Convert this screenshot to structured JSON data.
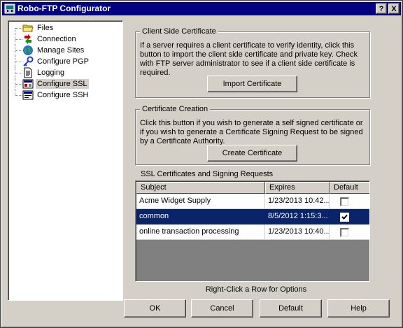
{
  "window": {
    "title": "Robo-FTP Configurator",
    "help_glyph": "?",
    "close_glyph": "X"
  },
  "tree": {
    "items": [
      {
        "label": "Files",
        "icon": "folder-icon"
      },
      {
        "label": "Connection",
        "icon": "connection-icon"
      },
      {
        "label": "Manage Sites",
        "icon": "globe-icon"
      },
      {
        "label": "Configure PGP",
        "icon": "key-icon"
      },
      {
        "label": "Logging",
        "icon": "document-icon"
      },
      {
        "label": "Configure SSL",
        "icon": "ssl-icon",
        "selected": true
      },
      {
        "label": "Configure SSH",
        "icon": "ssh-icon"
      }
    ]
  },
  "client_cert": {
    "title": "Client Side Certificate",
    "text": "If a server requires a client certificate to verify identity, click this button to import the client side certificate and private key. Check with FTP server administrator to see if a client side certificate is required.",
    "button": "Import Certificate"
  },
  "cert_creation": {
    "title": "Certificate Creation",
    "text": "Click this button if you wish to generate a self signed certificate or if you wish to generate a Certificate Signing Request to be signed by a Certificate Authority.",
    "button": "Create Certificate"
  },
  "ssl_list": {
    "title": "SSL Certificates and Signing Requests",
    "columns": [
      "Subject",
      "Expires",
      "Default"
    ],
    "rows": [
      {
        "subject": "Acme Widget Supply",
        "expires": "1/23/2013 10:42...",
        "default": false
      },
      {
        "subject": "common",
        "expires": "8/5/2012 1:15:3...",
        "default": true
      },
      {
        "subject": "online transaction processing",
        "expires": "1/23/2013 10:40...",
        "default": false
      }
    ],
    "hint": "Right-Click a Row for Options"
  },
  "buttons": {
    "ok": "OK",
    "cancel": "Cancel",
    "default": "Default",
    "help": "Help"
  },
  "colors": {
    "titlebar": "#000080",
    "face": "#d4d0c8",
    "selection": "#0a246a"
  }
}
